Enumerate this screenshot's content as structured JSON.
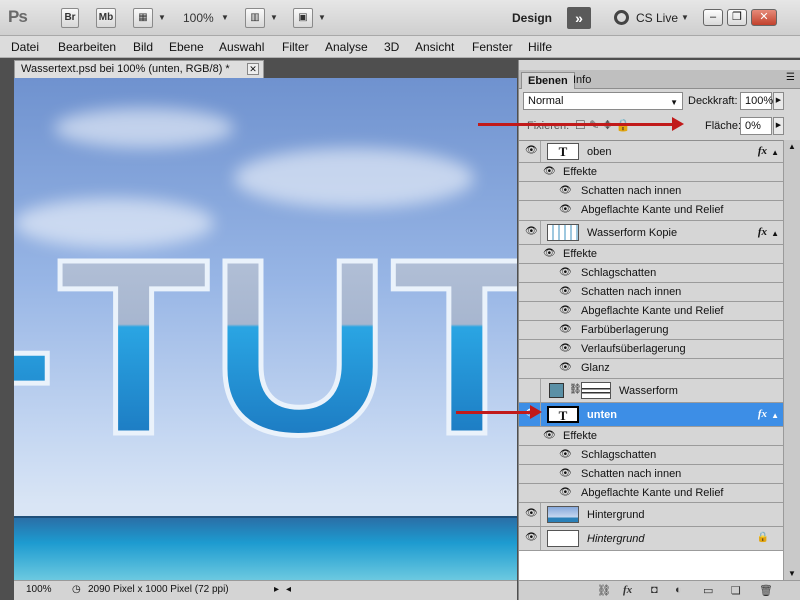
{
  "app": {
    "logo": "Ps",
    "buttons": [
      "Br",
      "Mb"
    ],
    "zoom": "100%",
    "workspace": "Design",
    "cs_live": "CS Live"
  },
  "menu": [
    "Datei",
    "Bearbeiten",
    "Bild",
    "Ebene",
    "Auswahl",
    "Filter",
    "Analyse",
    "3D",
    "Ansicht",
    "Fenster",
    "Hilfe"
  ],
  "document": {
    "tab_title": "Wassertext.psd bei 100% (unten, RGB/8) *",
    "status_zoom": "100%",
    "status_info": "2090 Pixel x 1000 Pixel (72 ppi)",
    "canvas_text": "-TUTO"
  },
  "layers_panel": {
    "tabs": [
      "Ebenen",
      "Info"
    ],
    "blend_mode": "Normal",
    "opacity_label": "Deckkraft:",
    "opacity_value": "100%",
    "lock_label": "Fixieren:",
    "fill_label": "Fläche:",
    "fill_value": "0%",
    "layers": [
      {
        "name": "oben",
        "thumb": "T",
        "fx": "fx",
        "effects_label": "Effekte",
        "effects": [
          "Schatten nach innen",
          "Abgeflachte Kante und Relief"
        ]
      },
      {
        "name": "Wasserform Kopie",
        "fx": "fx",
        "effects_label": "Effekte",
        "effects": [
          "Schlagschatten",
          "Schatten nach innen",
          "Abgeflachte Kante und Relief",
          "Farbüberlagerung",
          "Verlaufsüberlagerung",
          "Glanz"
        ]
      },
      {
        "name": "Wasserform"
      },
      {
        "name": "unten",
        "thumb": "T",
        "fx": "fx",
        "effects_label": "Effekte",
        "effects": [
          "Schlagschatten",
          "Schatten nach innen",
          "Abgeflachte Kante und Relief"
        ],
        "selected": true
      },
      {
        "name": "Hintergrund"
      },
      {
        "name": "Hintergrund",
        "locked": true
      }
    ]
  },
  "colors": {
    "selection": "#3d8ee6",
    "annotation_arrow": "#c11a1a"
  }
}
